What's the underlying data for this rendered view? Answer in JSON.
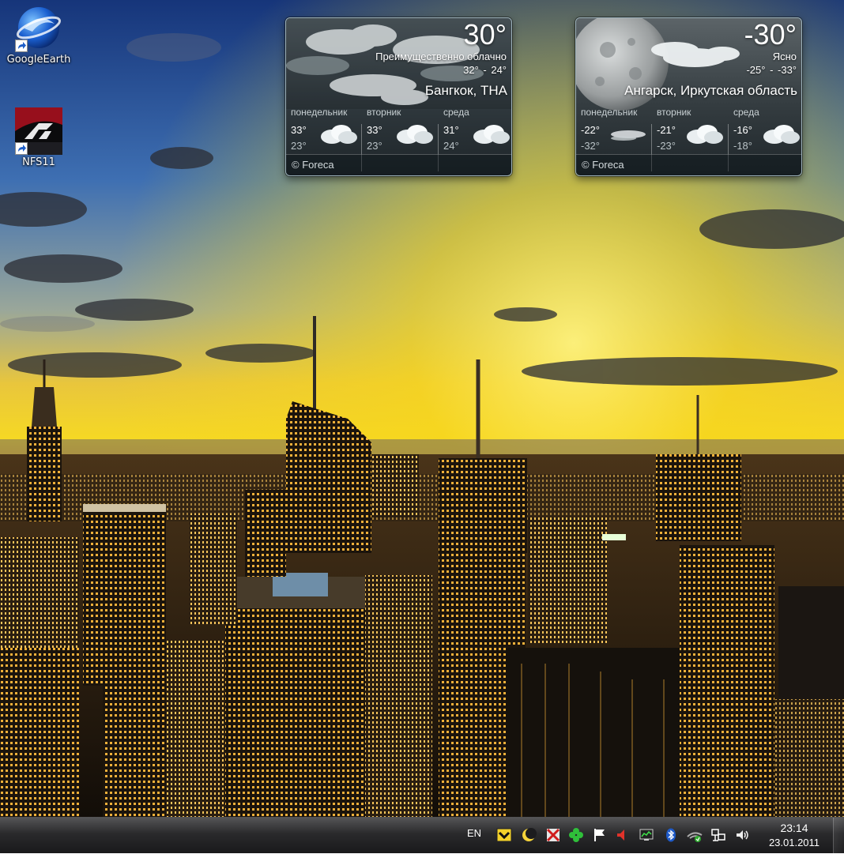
{
  "desktop": {
    "icons": [
      {
        "label": "GoogleEarth",
        "icon": "google-earth-icon"
      },
      {
        "label": "NFS11",
        "icon": "nfs-game-icon"
      }
    ]
  },
  "gadgets": [
    {
      "temp": "30°",
      "condition": "Преимущественно облачно",
      "range": "32° - 24°",
      "city": "Бангкок, THA",
      "days": [
        {
          "name": "понедельник",
          "hi": "33°",
          "lo": "23°",
          "icon": "cloudy-icon"
        },
        {
          "name": "вторник",
          "hi": "33°",
          "lo": "23°",
          "icon": "cloudy-icon"
        },
        {
          "name": "среда",
          "hi": "31°",
          "lo": "24°",
          "icon": "cloudy-icon"
        }
      ],
      "footer": "© Foreca"
    },
    {
      "temp": "-30°",
      "condition": "Ясно",
      "range": "-25° - -33°",
      "city": "Ангарск, Иркутская область",
      "days": [
        {
          "name": "понедельник",
          "hi": "-22°",
          "lo": "-32°",
          "icon": "haze-icon"
        },
        {
          "name": "вторник",
          "hi": "-21°",
          "lo": "-23°",
          "icon": "cloudy-icon"
        },
        {
          "name": "среда",
          "hi": "-16°",
          "lo": "-18°",
          "icon": "cloudy-icon"
        }
      ],
      "footer": "© Foreca"
    }
  ],
  "taskbar": {
    "language": "EN",
    "tray_icons": [
      "app-tray-icon",
      "moon-tray-icon",
      "antivirus-tray-icon",
      "clover-tray-icon",
      "flag-action-center-icon",
      "speaker-arrow-icon",
      "monitor-tray-icon",
      "bluetooth-icon",
      "wifi-disconnected-icon",
      "network-icon",
      "volume-icon"
    ],
    "time": "23:14",
    "date": "23.01.2011"
  },
  "colors": {
    "sky_top": "#1d3f86",
    "sky_glow": "#f4d21e",
    "city_dark": "#1a140d",
    "window_lights": "#f1b23c",
    "taskbar": "#1e1e20"
  }
}
